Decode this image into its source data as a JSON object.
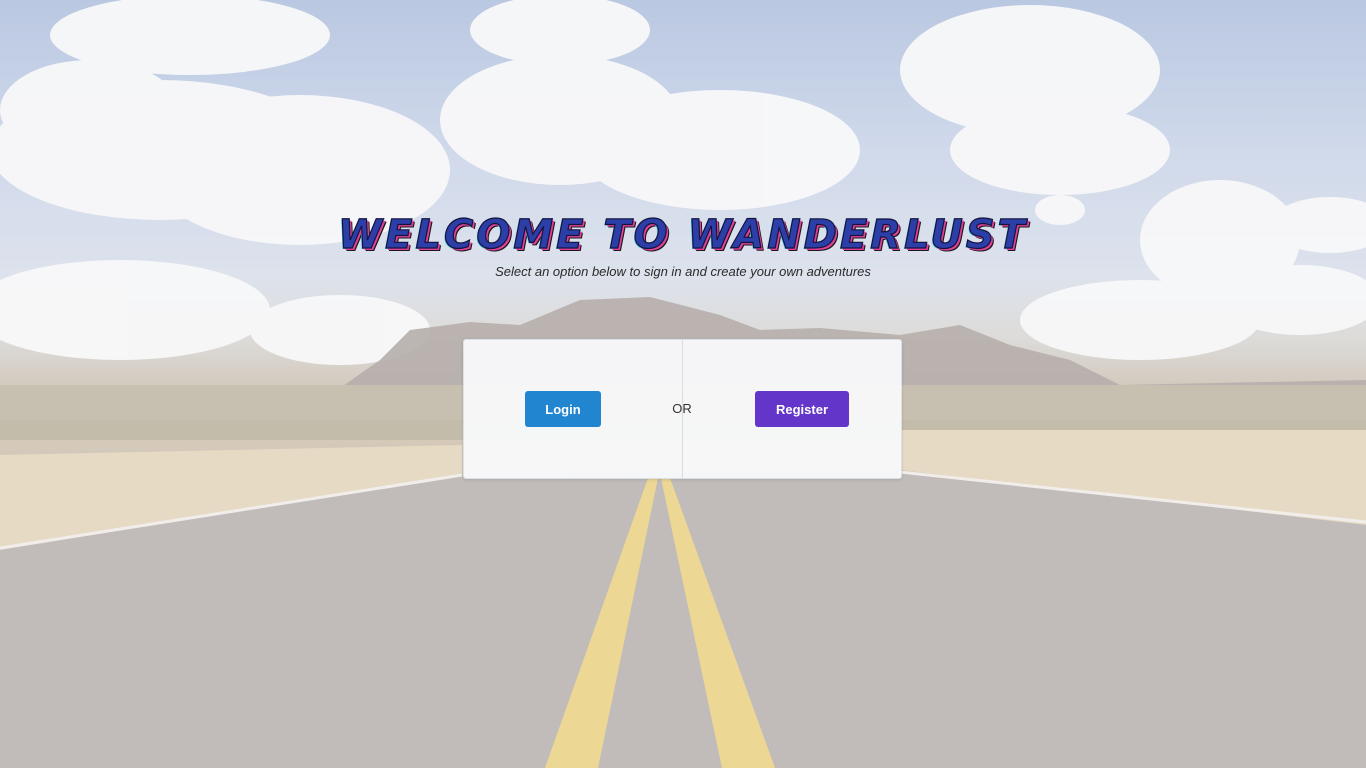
{
  "hero": {
    "title": "WELCOME TO WANDERLUST",
    "subtitle": "Select an option below to sign in and create your own adventures"
  },
  "auth_panel": {
    "login_label": "Login",
    "separator": "OR",
    "register_label": "Register"
  },
  "colors": {
    "login_button": "#2185d0",
    "register_button": "#6435c9"
  },
  "background": {
    "description_icon": "desert-road-photo"
  }
}
